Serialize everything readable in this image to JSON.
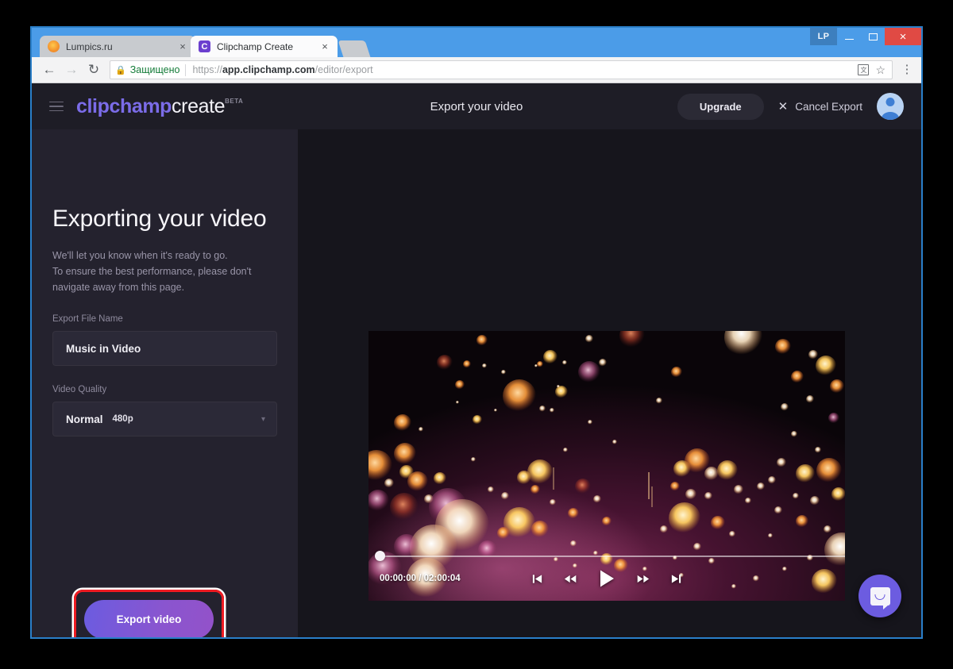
{
  "browser": {
    "window_controls": {
      "user_badge": "LP",
      "minimize": "minimize-button",
      "maximize": "maximize-button",
      "close": "×"
    },
    "tabs": [
      {
        "title": "Lumpics.ru",
        "favicon": "orange-circle-icon",
        "active": false,
        "close": "×"
      },
      {
        "title": "Clipchamp Create",
        "favicon": "C",
        "active": true,
        "close": "×"
      }
    ],
    "new_tab_label": "",
    "nav": {
      "back": "←",
      "forward": "→",
      "reload": "↻"
    },
    "omnibox": {
      "lock": "🔒",
      "secure_label": "Защищено",
      "url_scheme": "https://",
      "url_host": "app.clipchamp.com",
      "url_path": "/editor/export",
      "translate_icon": "translate-icon",
      "star_icon": "☆",
      "menu_icon": "⋮"
    }
  },
  "app": {
    "header": {
      "menu_icon": "hamburger-icon",
      "brand_first": "clipchamp",
      "brand_second": "create",
      "brand_badge": "BETA",
      "title": "Export your video",
      "upgrade_label": "Upgrade",
      "cancel_icon": "✕",
      "cancel_label": "Cancel Export",
      "avatar": "user-avatar"
    },
    "left_panel": {
      "heading": "Exporting your video",
      "description": "We'll let you know when it's ready to go.\nTo ensure the best performance, please don't navigate away from this page.",
      "file_name_label": "Export File Name",
      "file_name_value": "Music in Video",
      "file_name_placeholder": "Export File Name",
      "quality_label": "Video Quality",
      "quality_name": "Normal",
      "quality_resolution": "480p",
      "quality_chevron": "▾",
      "export_button_label": "Export video",
      "highlight_color": "#ee1b22"
    },
    "player": {
      "current_time": "00:00:00",
      "separator": "/",
      "duration": "02:00:04",
      "time_display": "00:00:00 / 02:00:04",
      "progress_percent": 0,
      "controls": [
        {
          "name": "skip-to-start-icon",
          "glyph": "⏮"
        },
        {
          "name": "rewind-icon",
          "glyph": "⏪"
        },
        {
          "name": "play-icon",
          "glyph": "▶"
        },
        {
          "name": "fast-forward-icon",
          "glyph": "⏩"
        },
        {
          "name": "skip-to-end-icon",
          "glyph": "⏭"
        }
      ]
    },
    "chat": {
      "icon": "chat-bubble-icon"
    },
    "colors": {
      "brand_purple": "#7b6ce8",
      "panel_bg": "#24222e",
      "stage_bg": "#16151c",
      "header_bg": "#1e1d26",
      "accent_button": "#7a58d8"
    }
  }
}
